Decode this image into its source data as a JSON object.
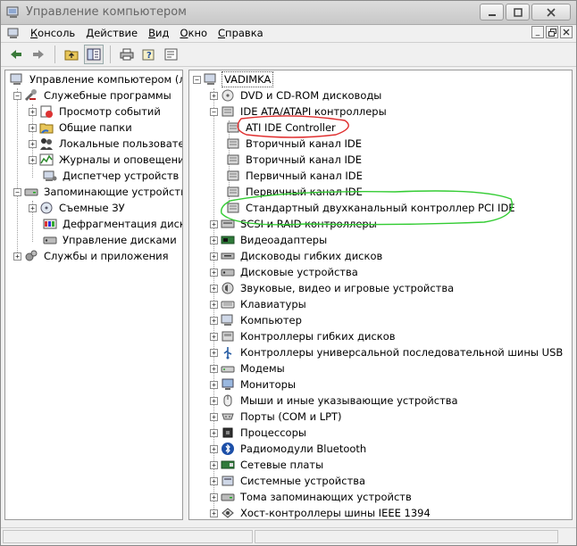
{
  "window": {
    "title": "Управление компьютером"
  },
  "menu": {
    "items": [
      {
        "first": "К",
        "rest": "онсоль"
      },
      {
        "first": "Д",
        "rest": "ействие"
      },
      {
        "first": "В",
        "rest": "ид"
      },
      {
        "first": "О",
        "rest": "кно"
      },
      {
        "first": "С",
        "rest": "правка"
      }
    ]
  },
  "left_tree": {
    "root": "Управление компьютером (лок",
    "groups": [
      {
        "label": "Служебные программы",
        "children": [
          "Просмотр событий",
          "Общие папки",
          "Локальные пользовате",
          "Журналы и оповещения",
          "Диспетчер устройств"
        ]
      },
      {
        "label": "Запоминающие устройства",
        "children": [
          "Съемные ЗУ",
          "Дефрагментация диска",
          "Управление дисками"
        ]
      },
      {
        "label": "Службы и приложения",
        "children": []
      }
    ]
  },
  "right_tree": {
    "root": "VADIMKA",
    "items": [
      {
        "label": "DVD и CD-ROM дисководы",
        "icon": "cdrom-icon"
      },
      {
        "label": "IDE ATA/ATAPI контроллеры",
        "icon": "ide-controller-icon"
      },
      {
        "label": "ATI IDE Controller",
        "icon": "ide-controller-icon",
        "child": true
      },
      {
        "label": "Вторичный канал IDE",
        "icon": "ide-controller-icon",
        "child": true
      },
      {
        "label": "Вторичный канал IDE",
        "icon": "ide-controller-icon",
        "child": true
      },
      {
        "label": "Первичный канал IDE",
        "icon": "ide-controller-icon",
        "child": true
      },
      {
        "label": "Первичный канал IDE",
        "icon": "ide-controller-icon",
        "child": true
      },
      {
        "label": "Стандартный двухканальный контроллер PCI IDE",
        "icon": "ide-controller-icon",
        "child": true
      },
      {
        "label": "SCSI и RAID контроллеры",
        "icon": "scsi-icon"
      },
      {
        "label": "Видеоадаптеры",
        "icon": "display-adapter-icon"
      },
      {
        "label": "Дисководы гибких дисков",
        "icon": "floppy-drive-icon"
      },
      {
        "label": "Дисковые устройства",
        "icon": "disk-drive-icon"
      },
      {
        "label": "Звуковые, видео и игровые устройства",
        "icon": "sound-icon"
      },
      {
        "label": "Клавиатуры",
        "icon": "keyboard-icon"
      },
      {
        "label": "Компьютер",
        "icon": "computer-icon"
      },
      {
        "label": "Контроллеры гибких дисков",
        "icon": "floppy-controller-icon"
      },
      {
        "label": "Контроллеры универсальной последовательной шины USB",
        "icon": "usb-icon"
      },
      {
        "label": "Модемы",
        "icon": "modem-icon"
      },
      {
        "label": "Мониторы",
        "icon": "monitor-icon"
      },
      {
        "label": "Мыши и иные указывающие устройства",
        "icon": "mouse-icon"
      },
      {
        "label": "Порты (COM и LPT)",
        "icon": "port-icon"
      },
      {
        "label": "Процессоры",
        "icon": "processor-icon"
      },
      {
        "label": "Радиомодули Bluetooth",
        "icon": "bluetooth-icon"
      },
      {
        "label": "Сетевые платы",
        "icon": "network-card-icon"
      },
      {
        "label": "Системные устройства",
        "icon": "system-device-icon"
      },
      {
        "label": "Тома запоминающих устройств",
        "icon": "storage-volume-icon"
      },
      {
        "label": "Хост-контроллеры шины IEEE 1394",
        "icon": "ieee1394-icon"
      }
    ]
  },
  "colors": {
    "red_highlight": "#e03030",
    "green_highlight": "#33cc33"
  }
}
